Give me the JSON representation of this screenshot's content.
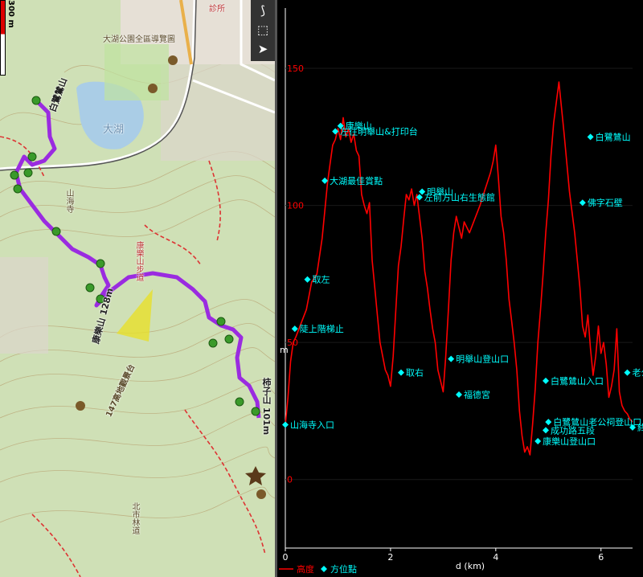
{
  "map": {
    "scale_label": "300 m",
    "toolbar": [
      {
        "icon": "route-icon",
        "glyph": "⟆"
      },
      {
        "icon": "select-area-icon",
        "glyph": "⬚"
      },
      {
        "icon": "compass-icon",
        "glyph": "➤"
      }
    ],
    "labels": [
      {
        "name": "map-label-lake-park",
        "text": "大湖公園全區導覽圖",
        "cls": ""
      },
      {
        "name": "map-label-big-lake",
        "text": "大湖",
        "cls": "lake"
      },
      {
        "name": "map-label-baihu",
        "text": "白鷺鷥山",
        "cls": "bold"
      },
      {
        "name": "map-label-shanhai",
        "text": "山海寺",
        "cls": "vert"
      },
      {
        "name": "map-label-trail",
        "text": "康樂山步道",
        "cls": "vert red"
      },
      {
        "name": "map-label-peak128",
        "text": "康樂山 128m",
        "cls": "bold"
      },
      {
        "name": "map-label-peak101",
        "text": "柿子山 101m",
        "cls": "bold vert"
      },
      {
        "name": "map-label-147",
        "text": "147高地觀景台",
        "cls": ""
      },
      {
        "name": "map-label-road",
        "text": "北市林道",
        "cls": "vert"
      },
      {
        "name": "map-label-clinic",
        "text": "診所",
        "cls": "red"
      }
    ]
  },
  "chart_data": {
    "type": "line",
    "xlabel": "d (km)",
    "ylabel": "m",
    "xlim": [
      0,
      6.6
    ],
    "ylim": [
      -25,
      172
    ],
    "x_ticks": [
      0,
      2,
      4,
      6
    ],
    "y_ticks": [
      0,
      50,
      100,
      150
    ],
    "legend": [
      {
        "label": "高度",
        "marker": "line",
        "color": "#ff0000"
      },
      {
        "label": "方位點",
        "marker": "diamond",
        "color": "#00ffff"
      }
    ],
    "series": [
      {
        "name": "高度",
        "color": "#ff0000",
        "x": [
          0.0,
          0.05,
          0.1,
          0.15,
          0.2,
          0.3,
          0.4,
          0.5,
          0.6,
          0.7,
          0.8,
          0.85,
          0.9,
          0.95,
          1.0,
          1.05,
          1.1,
          1.15,
          1.2,
          1.25,
          1.3,
          1.35,
          1.4,
          1.45,
          1.5,
          1.55,
          1.6,
          1.65,
          1.7,
          1.75,
          1.8,
          1.85,
          1.9,
          1.95,
          2.0,
          2.05,
          2.1,
          2.15,
          2.2,
          2.25,
          2.3,
          2.35,
          2.4,
          2.45,
          2.5,
          2.55,
          2.6,
          2.65,
          2.7,
          2.75,
          2.8,
          2.85,
          2.9,
          2.95,
          3.0,
          3.05,
          3.1,
          3.15,
          3.2,
          3.25,
          3.3,
          3.35,
          3.4,
          3.5,
          3.6,
          3.7,
          3.8,
          3.9,
          3.95,
          4.0,
          4.05,
          4.1,
          4.15,
          4.2,
          4.25,
          4.3,
          4.35,
          4.4,
          4.45,
          4.5,
          4.55,
          4.6,
          4.65,
          4.7,
          4.75,
          4.8,
          4.85,
          4.9,
          4.95,
          5.0,
          5.05,
          5.1,
          5.2,
          5.3,
          5.4,
          5.5,
          5.6,
          5.65,
          5.7,
          5.75,
          5.8,
          5.85,
          5.9,
          5.95,
          6.0,
          6.05,
          6.1,
          6.15,
          6.2,
          6.25,
          6.3,
          6.35,
          6.4,
          6.45,
          6.5,
          6.55,
          6.6
        ],
        "y": [
          20,
          30,
          43,
          50,
          52,
          57,
          62,
          72,
          75,
          88,
          108,
          115,
          122,
          124,
          128,
          124,
          132,
          125,
          128,
          123,
          126,
          120,
          118,
          104,
          100,
          97,
          101,
          80,
          70,
          60,
          50,
          45,
          40,
          38,
          34,
          45,
          62,
          78,
          85,
          95,
          104,
          102,
          106,
          100,
          104,
          96,
          88,
          76,
          70,
          62,
          55,
          50,
          40,
          36,
          32,
          45,
          62,
          80,
          90,
          96,
          92,
          88,
          94,
          90,
          95,
          100,
          106,
          112,
          116,
          122,
          110,
          96,
          90,
          80,
          66,
          58,
          50,
          40,
          25,
          16,
          10,
          12,
          9,
          20,
          33,
          50,
          62,
          75,
          90,
          102,
          118,
          130,
          145,
          126,
          105,
          90,
          70,
          56,
          52,
          60,
          48,
          38,
          45,
          56,
          46,
          50,
          42,
          30,
          34,
          40,
          55,
          32,
          27,
          25,
          24,
          22,
          21
        ]
      }
    ],
    "waypoints": [
      {
        "label": "山海寺入口",
        "x": 0.0,
        "y": 20
      },
      {
        "label": "陡上階梯止",
        "x": 0.18,
        "y": 55
      },
      {
        "label": "取左",
        "x": 0.42,
        "y": 73
      },
      {
        "label": "大湖最佳賞點",
        "x": 0.75,
        "y": 109
      },
      {
        "label": "康樂山",
        "x": 1.05,
        "y": 129
      },
      {
        "label": "左往明舉山&打印台",
        "x": 0.95,
        "y": 127
      },
      {
        "label": "取右",
        "x": 2.2,
        "y": 39
      },
      {
        "label": "明舉山",
        "x": 2.6,
        "y": 105
      },
      {
        "label": "左前方山右生態館",
        "x": 2.55,
        "y": 103
      },
      {
        "label": "明舉山登山口",
        "x": 3.15,
        "y": 44
      },
      {
        "label": "福德宮",
        "x": 3.3,
        "y": 31
      },
      {
        "label": "白鷺鷥山入口",
        "x": 4.95,
        "y": 36
      },
      {
        "label": "白鷺鷥山老公祠登山口",
        "x": 5.0,
        "y": 21
      },
      {
        "label": "成功路五段",
        "x": 4.95,
        "y": 18
      },
      {
        "label": "康樂山登山口",
        "x": 4.8,
        "y": 14
      },
      {
        "label": "佛字石壁",
        "x": 5.65,
        "y": 101
      },
      {
        "label": "白鷺鷥山",
        "x": 5.8,
        "y": 125
      },
      {
        "label": "老公",
        "x": 6.5,
        "y": 39
      },
      {
        "label": "終",
        "x": 6.6,
        "y": 19
      }
    ]
  }
}
